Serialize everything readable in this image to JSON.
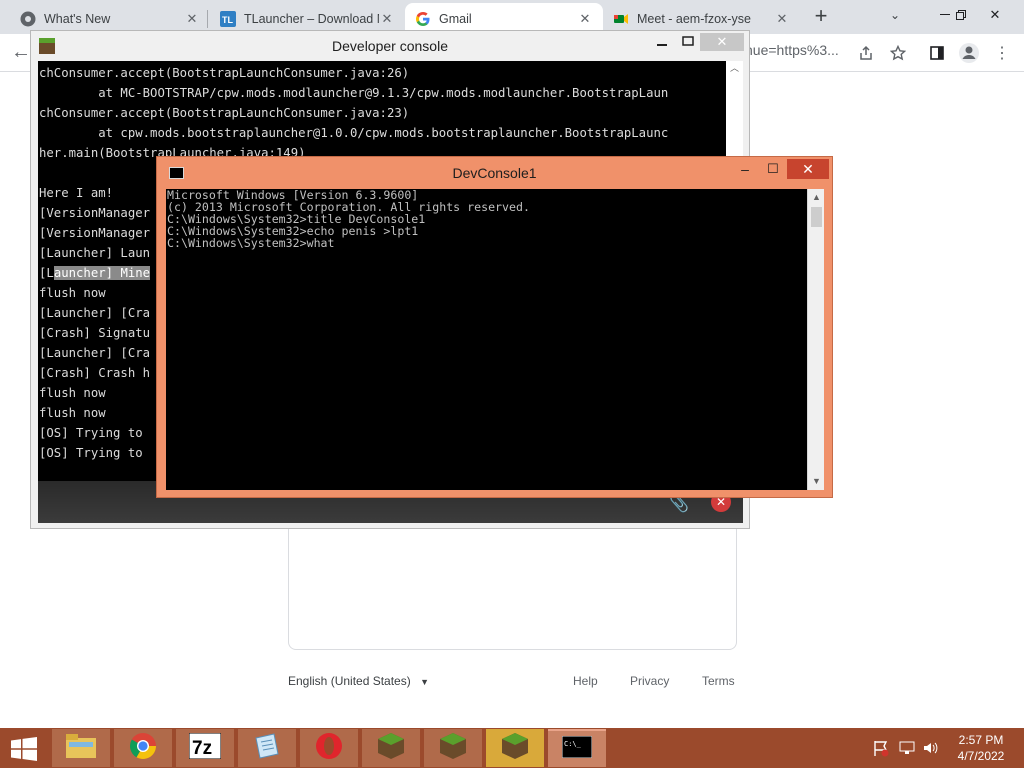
{
  "browser": {
    "tabs": [
      {
        "title": "What's New",
        "icon": "chrome-icon",
        "active": false
      },
      {
        "title": "TLauncher – Download M",
        "icon": "tlauncher-icon",
        "active": false
      },
      {
        "title": "Gmail",
        "icon": "google-icon",
        "active": true
      },
      {
        "title": "Meet - aem-fzox-yse",
        "icon": "meet-icon",
        "active": false
      }
    ],
    "new_tab_label": "+",
    "url_tail": "nue=https%3...",
    "back_glyph": "←"
  },
  "page": {
    "language": "English (United States)",
    "footer_links": [
      "Help",
      "Privacy",
      "Terms"
    ]
  },
  "devconsole": {
    "title": "Developer console",
    "lines": [
      "chConsumer.accept(BootstrapLaunchConsumer.java:26)",
      "        at MC-BOOTSTRAP/cpw.mods.modlauncher@9.1.3/cpw.mods.modlauncher.BootstrapLaun",
      "chConsumer.accept(BootstrapLaunchConsumer.java:23)",
      "        at cpw.mods.bootstraplauncher@1.0.0/cpw.mods.bootstraplauncher.BootstrapLaunc",
      "her.main(BootstrapLauncher.java:149)",
      "",
      "Here I am!",
      "[VersionManager",
      "[VersionManager",
      "[Launcher] Laun",
      "[Launcher] Mine",
      "flush now",
      "[Launcher] [Cra",
      "[Crash] Signatu",
      "[Launcher] [Cra",
      "[Crash] Crash h",
      "flush now",
      "flush now",
      "[OS] Trying to",
      "[OS] Trying to"
    ]
  },
  "cmd": {
    "title": "DevConsole1",
    "lines": [
      "Microsoft Windows [Version 6.3.9600]",
      "(c) 2013 Microsoft Corporation. All rights reserved.",
      "",
      "C:\\Windows\\System32>title DevConsole1",
      "",
      "C:\\Windows\\System32>echo penis >lpt1",
      "",
      "C:\\Windows\\System32>what"
    ]
  },
  "taskbar": {
    "apps": [
      "file-explorer-icon",
      "chrome-icon",
      "7zip-icon",
      "notepad-icon",
      "opera-icon",
      "minecraft-icon",
      "minecraft-icon",
      "minecraft-icon",
      "cmd-icon"
    ],
    "time": "2:57 PM",
    "date": "4/7/2022",
    "accent": "#9b4a2c"
  }
}
